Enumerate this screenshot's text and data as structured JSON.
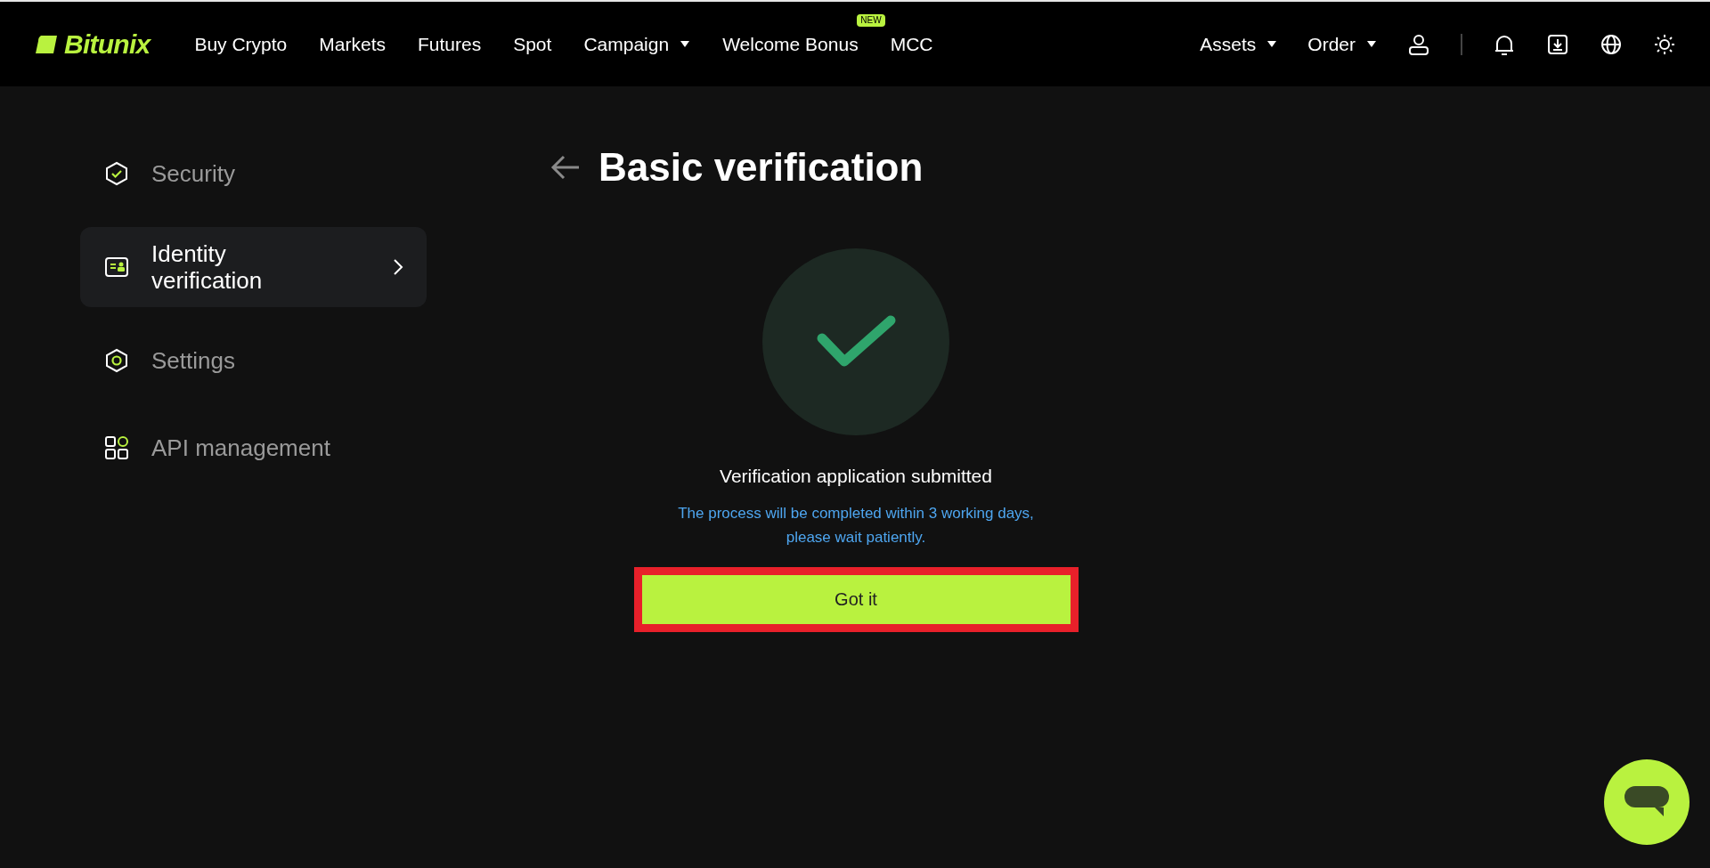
{
  "header": {
    "logo": "Bitunix",
    "nav": [
      {
        "label": "Buy Crypto",
        "dropdown": false
      },
      {
        "label": "Markets",
        "dropdown": false
      },
      {
        "label": "Futures",
        "dropdown": false
      },
      {
        "label": "Spot",
        "dropdown": false
      },
      {
        "label": "Campaign",
        "dropdown": true
      },
      {
        "label": "Welcome Bonus",
        "dropdown": false,
        "badge": "NEW"
      },
      {
        "label": "MCC",
        "dropdown": false
      }
    ],
    "right_menus": [
      {
        "label": "Assets",
        "dropdown": true
      },
      {
        "label": "Order",
        "dropdown": true
      }
    ]
  },
  "sidebar": {
    "items": [
      {
        "kind": "security",
        "label": "Security",
        "selected": false
      },
      {
        "kind": "identity",
        "label": "Identity verification",
        "selected": true
      },
      {
        "kind": "settings",
        "label": "Settings",
        "selected": false
      },
      {
        "kind": "api",
        "label": "API management",
        "selected": false
      }
    ]
  },
  "main": {
    "title": "Basic verification",
    "status": "Verification application submitted",
    "note": "The process will be completed within 3 working days, please wait patiently.",
    "button": "Got it"
  }
}
